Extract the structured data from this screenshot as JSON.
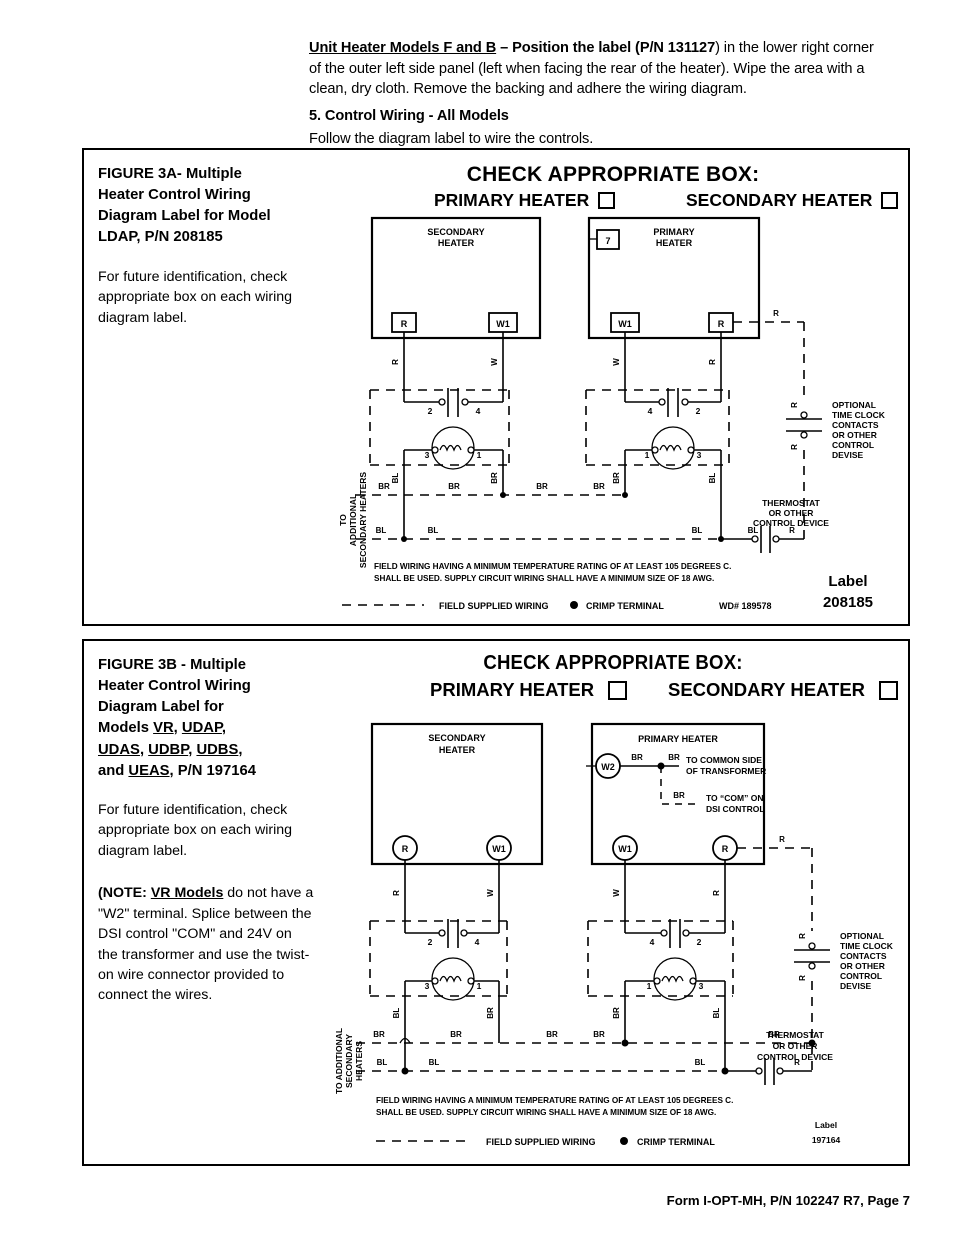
{
  "intro": {
    "para1_bold_lead": "Unit Heater Models F and B",
    "para1_dash": " – Position the label (",
    "para1_pn": "P/N 131127",
    "para1_rest": ") in the lower right corner of the outer left side panel (left when facing the rear of the heater). Wipe the area with a clean, dry cloth. Remove the backing and adhere the wiring diagram.",
    "step_heading": "5.  Control Wiring - All Models",
    "step_body": "Follow the diagram label to wire the controls."
  },
  "figure_3a": {
    "title_line1": "FIGURE 3A- Multiple",
    "title_line2": "Heater Control Wiring",
    "title_line3": "Diagram Label for Model",
    "title_line4": "LDAP, P/N 208185",
    "paragraph": "For future identification, check appropriate box on each wiring diagram label.",
    "check_title": "CHECK APPROPRIATE BOX:",
    "primary_label": "PRIMARY HEATER",
    "secondary_label": "SECONDARY HEATER",
    "box_secondary_line1": "SECONDARY",
    "box_secondary_line2": "HEATER",
    "box_primary_line1": "PRIMARY",
    "box_primary_line2": "HEATER",
    "terminal_7": "7",
    "terminal_r": "R",
    "terminal_w1": "W1",
    "wire_r": "R",
    "wire_w": "W",
    "wire_br": "BR",
    "wire_bl": "BL",
    "contact_2": "2",
    "contact_4": "4",
    "coil_3": "3",
    "coil_1": "1",
    "vertical_note_line1": "TO",
    "vertical_note_line2": "ADDITIONAL",
    "vertical_note_line3": "SECONDARY HEATERS",
    "optional_line1": "OPTIONAL",
    "optional_line2": "TIME CLOCK",
    "optional_line3": "CONTACTS",
    "optional_line4": "OR OTHER",
    "optional_line5": "CONTROL",
    "optional_line6": "DEVISE",
    "thermostat_line1": "THERMOSTAT",
    "thermostat_line2": "OR OTHER",
    "thermostat_line3": "CONTROL DEVICE",
    "note_line1": "FIELD WIRING HAVING A MINIMUM TEMPERATURE RATING OF AT LEAST 105 DEGREES C.",
    "note_line2": "SHALL BE USED.  SUPPLY CIRCUIT WIRING SHALL HAVE A MINIMUM SIZE OF 18 AWG.",
    "legend_field_wiring": "FIELD SUPPLIED WIRING",
    "legend_crimp": "CRIMP TERMINAL",
    "wd_number": "WD# 189578",
    "label_word": "Label",
    "label_number": "208185"
  },
  "figure_3b": {
    "title_line1": "FIGURE 3B - Multiple",
    "title_line2": "Heater Control Wiring",
    "title_line3": "Diagram Label for",
    "title_line4_pre": "Models ",
    "model_vr": "VR",
    "model_udap": "UDAP",
    "model_udas": "UDAS",
    "model_udbp": "UDBP",
    "model_udbs": "UDBS",
    "title_and": "and ",
    "model_ueas": "UEAS",
    "title_pn": ", P/N 197164",
    "paragraph": "For future identification, check appropriate box on each wiring diagram label.",
    "note_lead": "(NOTE: ",
    "note_models": "VR Models",
    "note_body": " do not have a \"W2\" terminal. Splice between the DSI control \"COM\" and 24V on the transformer and use the twist-on wire connector provided to connect the wires.",
    "check_title": "CHECK APPROPRIATE BOX:",
    "primary_label": "PRIMARY HEATER",
    "secondary_label": "SECONDARY HEATER",
    "box_secondary_line1": "SECONDARY",
    "box_secondary_line2": "HEATER",
    "box_primary": "PRIMARY HEATER",
    "terminal_w2": "W2",
    "terminal_w1": "W1",
    "terminal_r": "R",
    "wire_br": "BR",
    "wire_bl": "BL",
    "wire_r": "R",
    "wire_w": "W",
    "transformer_line1": "TO COMMON SIDE",
    "transformer_line2": "OF TRANSFORMER",
    "dsi_line1": "TO “COM” ON",
    "dsi_line2": "DSI CONTROL",
    "contact_2": "2",
    "contact_4": "4",
    "coil_3": "3",
    "coil_1": "1",
    "vertical_note_line1": "TO ADDITIONAL",
    "vertical_note_line2": "SECONDARY",
    "vertical_note_line3": "HEATERS",
    "optional_line1": "OPTIONAL",
    "optional_line2": "TIME CLOCK",
    "optional_line3": "CONTACTS",
    "optional_line4": "OR OTHER",
    "optional_line5": "CONTROL",
    "optional_line6": "DEVISE",
    "thermostat_line1": "THERMOSTAT",
    "thermostat_line2": "OR OTHER",
    "thermostat_line3": "CONTROL DEVICE",
    "note_line1": "FIELD WIRING HAVING A MINIMUM TEMPERATURE RATING OF AT LEAST 105 DEGREES C.",
    "note_line2": "SHALL BE USED.  SUPPLY CIRCUIT WIRING SHALL HAVE A MINIMUM SIZE OF 18 AWG.",
    "legend_field_wiring": "FIELD SUPPLIED WIRING",
    "legend_crimp": "CRIMP TERMINAL",
    "label_word": "Label",
    "label_number": "197164"
  },
  "footer": {
    "text": "Form I-OPT-MH, P/N 102247 R7, Page 7"
  }
}
